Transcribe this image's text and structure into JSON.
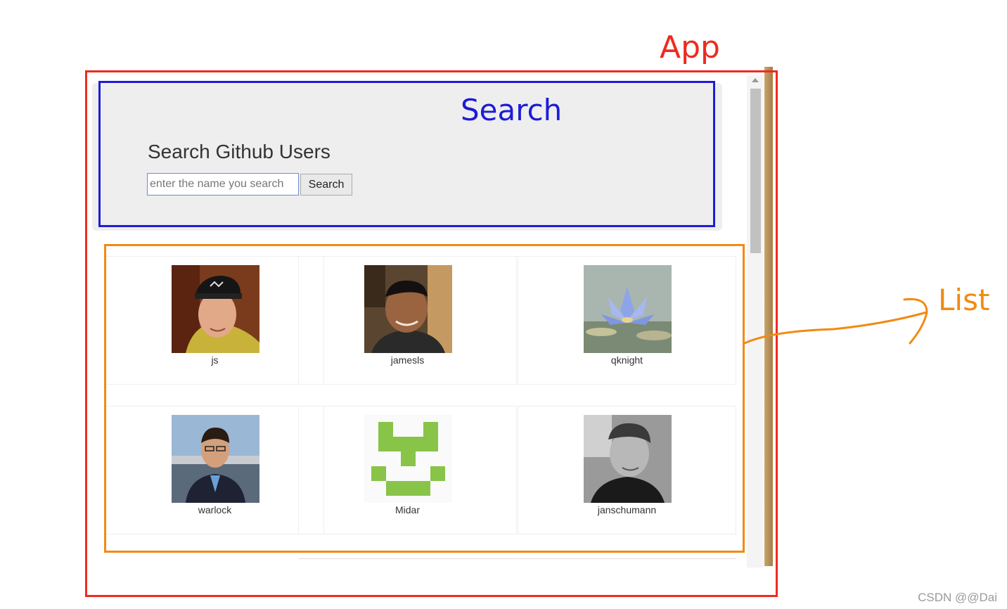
{
  "annotations": {
    "app_label": "App",
    "search_label": "Search",
    "list_label": "List",
    "colors": {
      "app": "#ee2b1f",
      "search": "#1c1cd8",
      "list": "#f28a12"
    }
  },
  "search": {
    "title": "Search Github Users",
    "placeholder": "enter the name you search",
    "button_label": "Search"
  },
  "users": [
    {
      "login": "js",
      "avatar": "photo-person-cap"
    },
    {
      "login": "jamesls",
      "avatar": "photo-person-smiling"
    },
    {
      "login": "qknight",
      "avatar": "photo-lotus-flower"
    },
    {
      "login": "warlock",
      "avatar": "photo-person-suit"
    },
    {
      "login": "Midar",
      "avatar": "identicon-green"
    },
    {
      "login": "janschumann",
      "avatar": "photo-person-bw"
    }
  ],
  "watermark": "CSDN @@Dai"
}
